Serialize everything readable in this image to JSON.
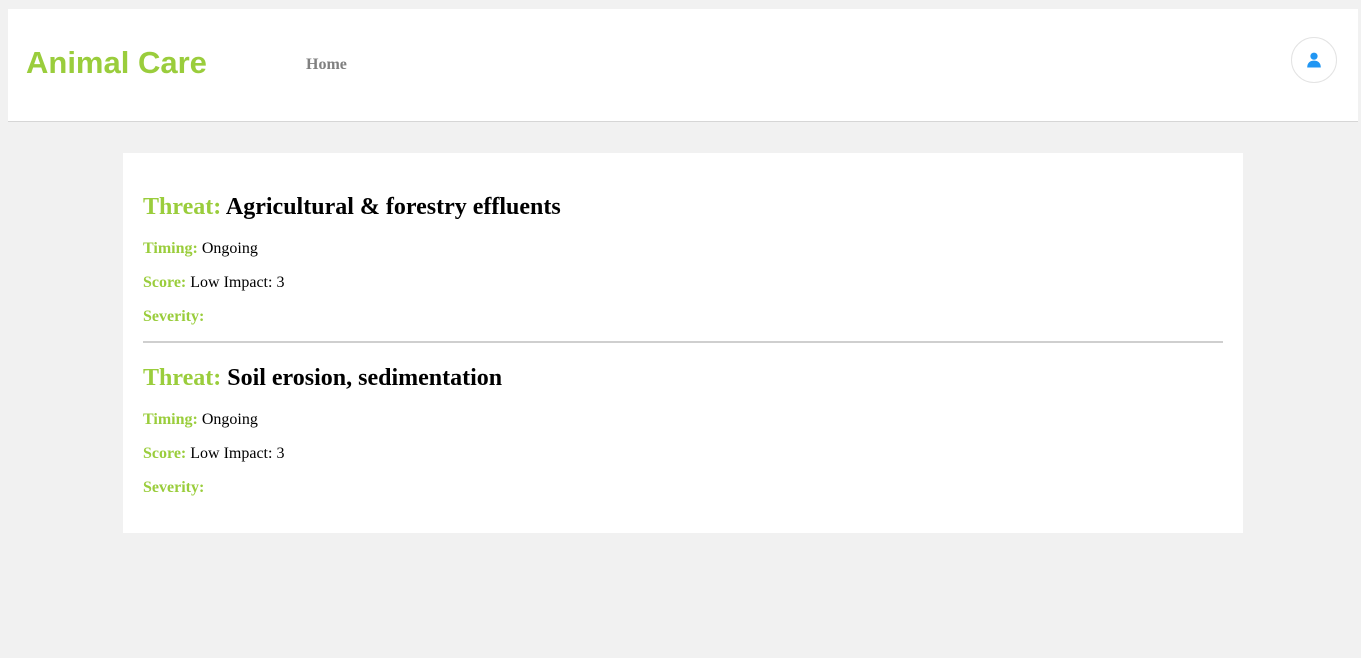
{
  "header": {
    "brand": "Animal Care",
    "nav": {
      "home_label": "Home"
    },
    "user_icon": "user-icon"
  },
  "threats": [
    {
      "title_label": "Threat:",
      "title": "Agricultural & forestry effluents",
      "timing_label": "Timing:",
      "timing": "Ongoing",
      "score_label": "Score:",
      "score": "Low Impact: 3",
      "severity_label": "Severity:",
      "severity": ""
    },
    {
      "title_label": "Threat:",
      "title": "Soil erosion, sedimentation",
      "timing_label": "Timing:",
      "timing": "Ongoing",
      "score_label": "Score:",
      "score": "Low Impact: 3",
      "severity_label": "Severity:",
      "severity": ""
    }
  ],
  "colors": {
    "accent": "#9acd3c",
    "nav_text": "#808080",
    "user_icon": "#2196f3",
    "page_bg": "#f1f1f1"
  }
}
